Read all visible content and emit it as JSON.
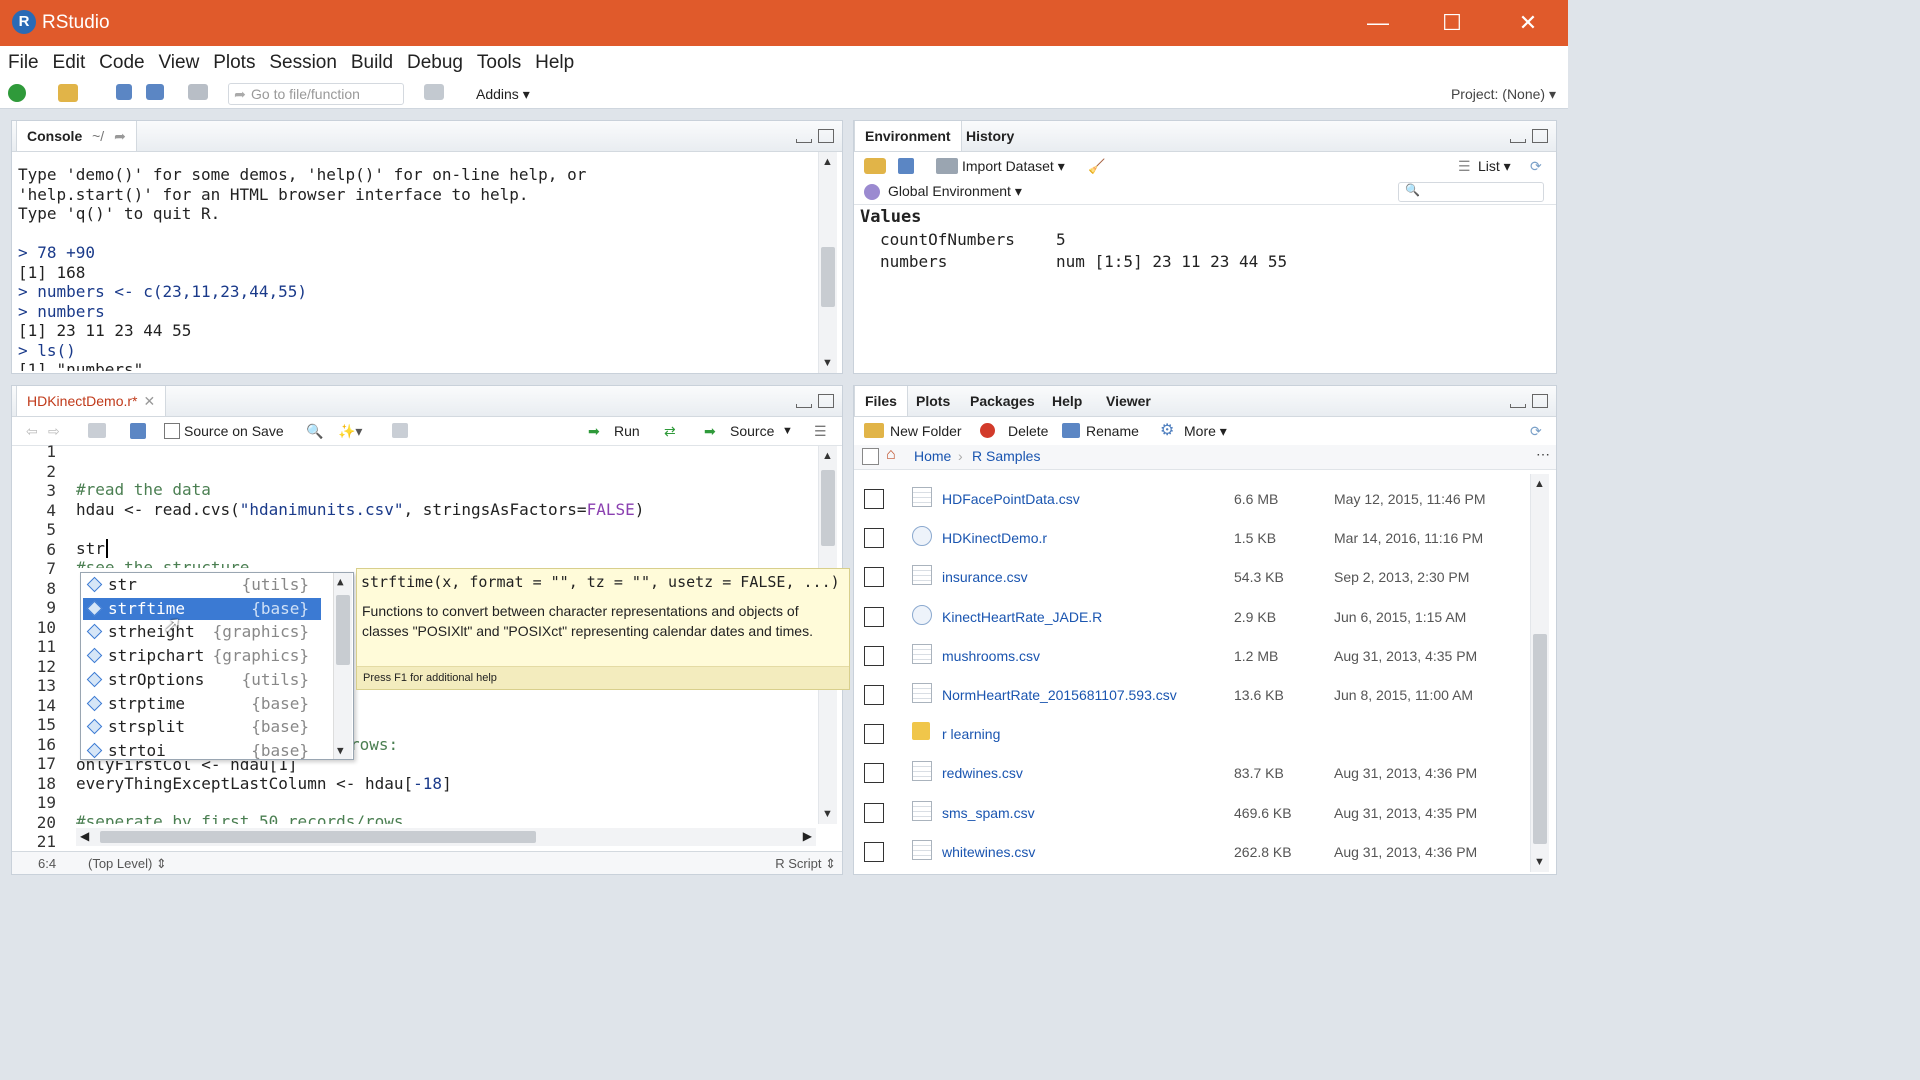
{
  "window": {
    "title": "RStudio",
    "logo_letter": "R",
    "min": "—",
    "max": "☐",
    "close": "✕"
  },
  "menu": [
    "File",
    "Edit",
    "Code",
    "View",
    "Plots",
    "Session",
    "Build",
    "Debug",
    "Tools",
    "Help"
  ],
  "toolbar": {
    "goto_placeholder": "Go to file/function",
    "addins": "Addins ▾",
    "project": "Project: (None) ▾"
  },
  "console": {
    "tab": "Console",
    "path": "~/",
    "lines": [
      {
        "t": "Type 'demo()' for some demos, 'help()' for on-line help, or",
        "c": ""
      },
      {
        "t": "'help.start()' for an HTML browser interface to help.",
        "c": ""
      },
      {
        "t": "Type 'q()' to quit R.",
        "c": ""
      },
      {
        "t": "",
        "c": ""
      },
      {
        "t": "> 78 +90",
        "c": "blue"
      },
      {
        "t": "[1] 168",
        "c": ""
      },
      {
        "t": "> numbers <- c(23,11,23,44,55)",
        "c": "blue"
      },
      {
        "t": "> numbers",
        "c": "blue"
      },
      {
        "t": "[1] 23 11 23 44 55",
        "c": ""
      },
      {
        "t": "> ls()",
        "c": "blue"
      },
      {
        "t": "[1] \"numbers\"",
        "c": ""
      }
    ]
  },
  "environment": {
    "tabs": [
      "Environment",
      "History"
    ],
    "import_dataset": "Import Dataset ▾",
    "list_view": "List ▾",
    "global_env": "Global Environment ▾",
    "section": "Values",
    "rows": [
      {
        "name": "countOfNumbers",
        "value": "5"
      },
      {
        "name": "numbers",
        "value": "num [1:5] 23 11 23 44 55"
      }
    ]
  },
  "editor": {
    "tab": "HDKinectDemo.r*",
    "source_on_save": "Source on Save",
    "run": "Run",
    "source": "Source",
    "line_numbers": [
      "1",
      "2",
      "3",
      "4",
      "5",
      "6",
      "7",
      "8",
      "9",
      "10",
      "11",
      "12",
      "13",
      "14",
      "15",
      "16",
      "17",
      "18",
      "19",
      "20",
      "21"
    ],
    "status_pos": "6:4",
    "status_scope": "(Top Level) ⇕",
    "status_type": "R Script ⇕"
  },
  "autocomplete": {
    "items": [
      {
        "name": "str",
        "pkg": "{utils}"
      },
      {
        "name": "strftime",
        "pkg": "{base}"
      },
      {
        "name": "strheight",
        "pkg": "{graphics}"
      },
      {
        "name": "stripchart",
        "pkg": "{graphics}"
      },
      {
        "name": "strOptions",
        "pkg": "{utils}"
      },
      {
        "name": "strptime",
        "pkg": "{base}"
      },
      {
        "name": "strsplit",
        "pkg": "{base}"
      },
      {
        "name": "strtoi",
        "pkg": "{base}"
      }
    ],
    "signature": "strftime(x, format = \"\", tz = \"\", usetz = FALSE, ...)",
    "description": "Functions to convert between character representations and objects of classes \"POSIXlt\" and \"POSIXct\" representing calendar dates and times.",
    "hint": "Press F1 for additional help"
  },
  "files": {
    "tabs": [
      "Files",
      "Plots",
      "Packages",
      "Help",
      "Viewer"
    ],
    "new_folder": "New Folder",
    "delete": "Delete",
    "rename": "Rename",
    "more": "More ▾",
    "breadcrumb": [
      "Home",
      "R Samples"
    ],
    "rows": [
      {
        "name": "HDFacePointData.csv",
        "size": "6.6 MB",
        "date": "May 12, 2015, 11:46 PM",
        "kind": "csv"
      },
      {
        "name": "HDKinectDemo.r",
        "size": "1.5 KB",
        "date": "Mar 14, 2016, 11:16 PM",
        "kind": "r"
      },
      {
        "name": "insurance.csv",
        "size": "54.3 KB",
        "date": "Sep 2, 2013, 2:30 PM",
        "kind": "csv"
      },
      {
        "name": "KinectHeartRate_JADE.R",
        "size": "2.9 KB",
        "date": "Jun 6, 2015, 1:15 AM",
        "kind": "r"
      },
      {
        "name": "mushrooms.csv",
        "size": "1.2 MB",
        "date": "Aug 31, 2013, 4:35 PM",
        "kind": "csv"
      },
      {
        "name": "NormHeartRate_2015681107.593.csv",
        "size": "13.6 KB",
        "date": "Jun 8, 2015, 11:00 AM",
        "kind": "csv"
      },
      {
        "name": "r learning",
        "size": "",
        "date": "",
        "kind": "folder"
      },
      {
        "name": "redwines.csv",
        "size": "83.7 KB",
        "date": "Aug 31, 2013, 4:36 PM",
        "kind": "csv"
      },
      {
        "name": "sms_spam.csv",
        "size": "469.6 KB",
        "date": "Aug 31, 2013, 4:35 PM",
        "kind": "csv"
      },
      {
        "name": "whitewines.csv",
        "size": "262.8 KB",
        "date": "Aug 31, 2013, 4:36 PM",
        "kind": "csv"
      }
    ]
  },
  "code": {
    "l3": "#read the data",
    "l4a": "hdau <- read.cvs(",
    "l4b": "\"hdanimunits.csv\"",
    "l4c": ", stringsAsFactors=",
    "l4d": "FALSE",
    "l4e": ")",
    "l6": "str",
    "l7": "#see the structure",
    "l16": "rows:",
    "l17": "onlyFirstCol <- hdau[1]",
    "l18a": "everyThingExceptLastColumn <- hdau[",
    "l18b": "-18",
    "l18c": "]",
    "l20": "#seperate by first 50 records/rows"
  }
}
